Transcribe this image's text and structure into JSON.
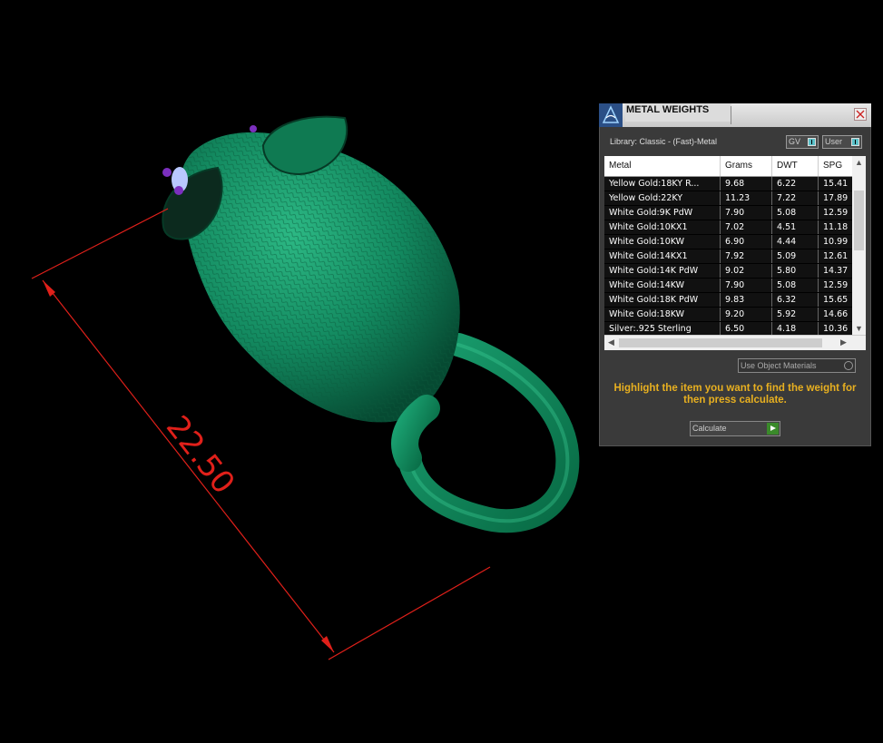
{
  "dimension": {
    "value": "22.50"
  },
  "panel": {
    "title": "METAL WEIGHTS",
    "library_label": "Library: Classic - (Fast)-Metal",
    "toggles": [
      {
        "label": "GV"
      },
      {
        "label": "User"
      }
    ],
    "table": {
      "columns": [
        "Metal",
        "Grams",
        "DWT",
        "SPG"
      ],
      "rows": [
        {
          "metal": "Yellow Gold:18KY R...",
          "grams": "9.68",
          "dwt": "6.22",
          "spg": "15.41"
        },
        {
          "metal": "Yellow Gold:22KY",
          "grams": "11.23",
          "dwt": "7.22",
          "spg": "17.89"
        },
        {
          "metal": "White Gold:9K PdW",
          "grams": "7.90",
          "dwt": "5.08",
          "spg": "12.59"
        },
        {
          "metal": "White Gold:10KX1",
          "grams": "7.02",
          "dwt": "4.51",
          "spg": "11.18"
        },
        {
          "metal": "White Gold:10KW",
          "grams": "6.90",
          "dwt": "4.44",
          "spg": "10.99"
        },
        {
          "metal": "White Gold:14KX1",
          "grams": "7.92",
          "dwt": "5.09",
          "spg": "12.61"
        },
        {
          "metal": "White Gold:14K PdW",
          "grams": "9.02",
          "dwt": "5.80",
          "spg": "14.37"
        },
        {
          "metal": "White Gold:14KW",
          "grams": "7.90",
          "dwt": "5.08",
          "spg": "12.59"
        },
        {
          "metal": "White Gold:18K PdW",
          "grams": "9.83",
          "dwt": "6.32",
          "spg": "15.65"
        },
        {
          "metal": "White Gold:18KW",
          "grams": "9.20",
          "dwt": "5.92",
          "spg": "14.66"
        },
        {
          "metal": "Silver:.925 Sterling",
          "grams": "6.50",
          "dwt": "4.18",
          "spg": "10.36"
        }
      ]
    },
    "use_materials_label": "Use Object Materials",
    "hint": "Highlight the item you want to find the weight for then press calculate.",
    "calculate_label": "Calculate",
    "colors": {
      "hint": "#e8b020",
      "model": "#138a60",
      "dimension": "#e0201a"
    }
  }
}
